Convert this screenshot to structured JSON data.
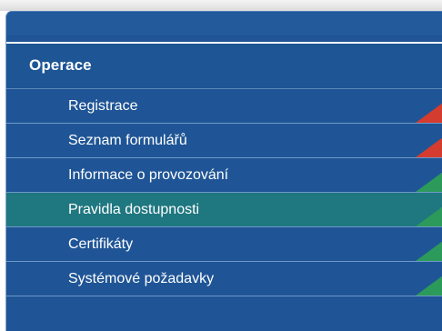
{
  "section": {
    "title": "Operace"
  },
  "menu": {
    "items": [
      {
        "label": "Registrace",
        "flag": "red-corner-flag"
      },
      {
        "label": "Seznam formulářů",
        "flag": "red-corner-flag"
      },
      {
        "label": "Informace o provozování",
        "flag": "green-corner-flag"
      },
      {
        "label": "Pravidla dostupnosti",
        "flag": "green-corner-flag",
        "active": true
      },
      {
        "label": "Certifikáty",
        "flag": "green-corner-flag"
      },
      {
        "label": "Systémové požadavky",
        "flag": "green-corner-flag"
      }
    ]
  },
  "colors": {
    "panel_blue": "#1f5596",
    "active_teal": "#1f7780",
    "flag_red": "#d33c2f",
    "flag_green": "#2c9a5b",
    "text_white": "#ffffff"
  }
}
